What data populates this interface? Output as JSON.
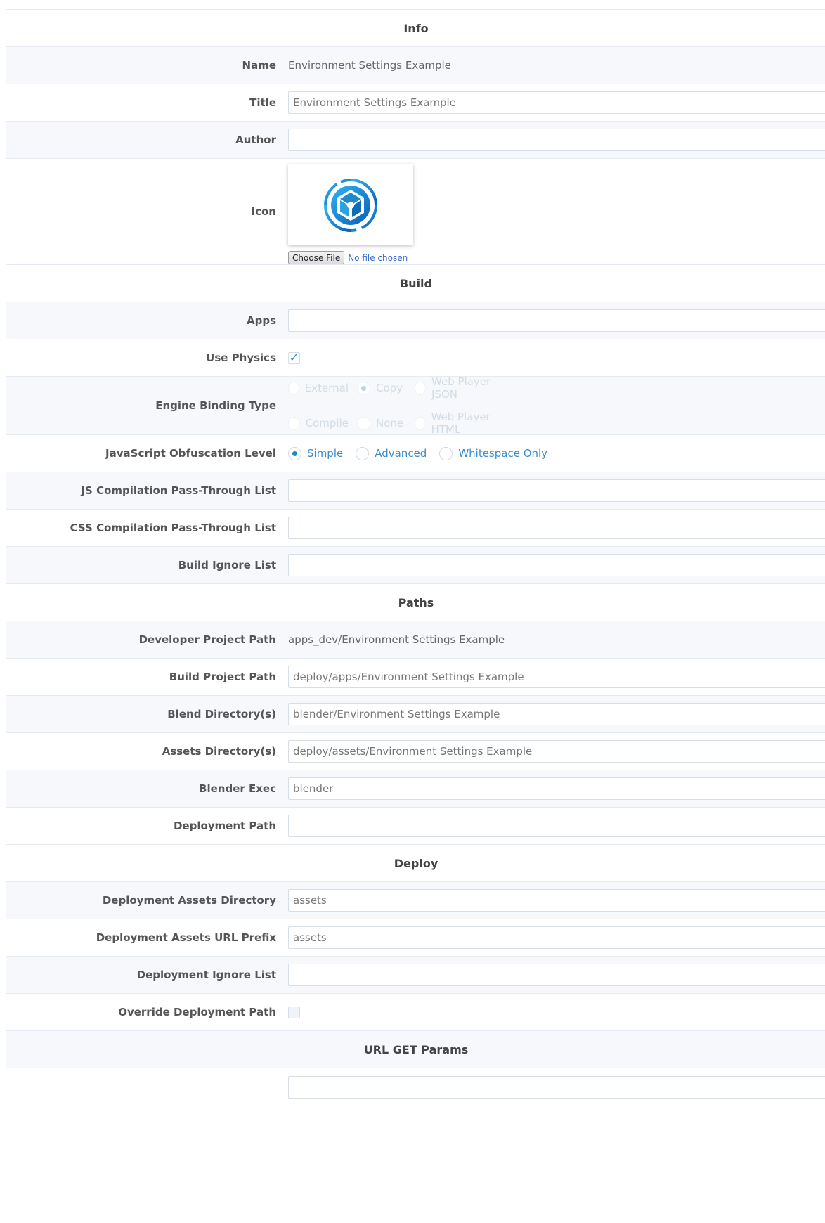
{
  "sections": {
    "info": "Info",
    "build": "Build",
    "paths": "Paths",
    "deploy": "Deploy",
    "url_get_params": "URL GET Params"
  },
  "info": {
    "name_label": "Name",
    "name_value": "Environment Settings Example",
    "title_label": "Title",
    "title_value": "Environment Settings Example",
    "author_label": "Author",
    "author_value": "",
    "icon_label": "Icon",
    "icon_image": "blend4web-logo-icon",
    "choose_file_label": "Choose File",
    "file_status": "No file chosen"
  },
  "build": {
    "apps_label": "Apps",
    "apps_value": "",
    "use_physics_label": "Use Physics",
    "use_physics_checked": true,
    "engine_binding_label": "Engine Binding Type",
    "engine_binding_options": [
      "External",
      "Copy",
      "Web Player JSON",
      "Compile",
      "None",
      "Web Player HTML"
    ],
    "engine_binding_selected": "Copy",
    "obfuscation_label": "JavaScript Obfuscation Level",
    "obfuscation_options": [
      "Simple",
      "Advanced",
      "Whitespace Only"
    ],
    "obfuscation_selected": "Simple",
    "js_passthrough_label": "JS Compilation Pass-Through List",
    "js_passthrough_value": "",
    "css_passthrough_label": "CSS Compilation Pass-Through List",
    "css_passthrough_value": "",
    "build_ignore_label": "Build Ignore List",
    "build_ignore_value": ""
  },
  "paths": {
    "dev_project_label": "Developer Project Path",
    "dev_project_value": "apps_dev/Environment Settings Example",
    "build_project_label": "Build Project Path",
    "build_project_value": "deploy/apps/Environment Settings Example",
    "blend_dir_label": "Blend Directory(s)",
    "blend_dir_value": "blender/Environment Settings Example",
    "assets_dir_label": "Assets Directory(s)",
    "assets_dir_value": "deploy/assets/Environment Settings Example",
    "blender_exec_label": "Blender Exec",
    "blender_exec_value": "blender",
    "deployment_path_label": "Deployment Path",
    "deployment_path_value": ""
  },
  "deploy": {
    "assets_dir_label": "Deployment Assets Directory",
    "assets_dir_value": "assets",
    "assets_url_label": "Deployment Assets URL Prefix",
    "assets_url_value": "assets",
    "ignore_label": "Deployment Ignore List",
    "ignore_value": "",
    "override_label": "Override Deployment Path",
    "override_checked": false
  },
  "url_params": {
    "param_value": ""
  },
  "colors": {
    "accent": "#1e88c8",
    "link": "#3a8bd0",
    "row_alt": "#f6f8fb",
    "border": "#e6ebf2"
  }
}
